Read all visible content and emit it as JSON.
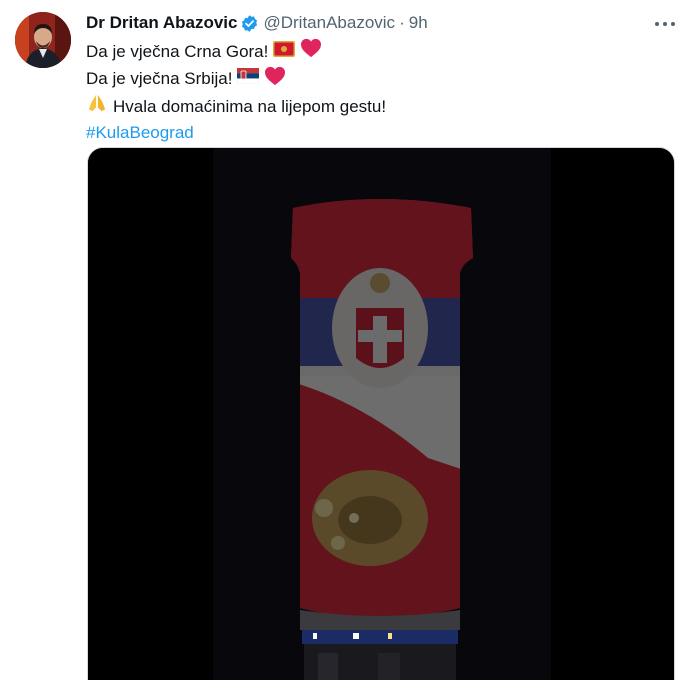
{
  "tweet": {
    "display_name": "Dr Dritan Abazovic",
    "handle": "@DritanAbazovic",
    "separator": "·",
    "time": "9h",
    "lines": [
      "Da je vječna Crna Gora!",
      "Da je vječna Srbija!",
      "Hvala domaćinima na lijepom gestu!"
    ],
    "hashtag": "#KulaBeograd",
    "icons": {
      "verified": "verified-badge-icon",
      "more": "more-options-icon",
      "montenegro_flag": "montenegro-flag-emoji",
      "serbia_flag": "serbia-flag-emoji",
      "heart": "red-heart-emoji",
      "pray": "folded-hands-emoji"
    },
    "colors": {
      "link": "#1d9bf0",
      "verified": "#1d9bf0",
      "secondary_text": "#536471",
      "heart": "#e0245e"
    }
  }
}
